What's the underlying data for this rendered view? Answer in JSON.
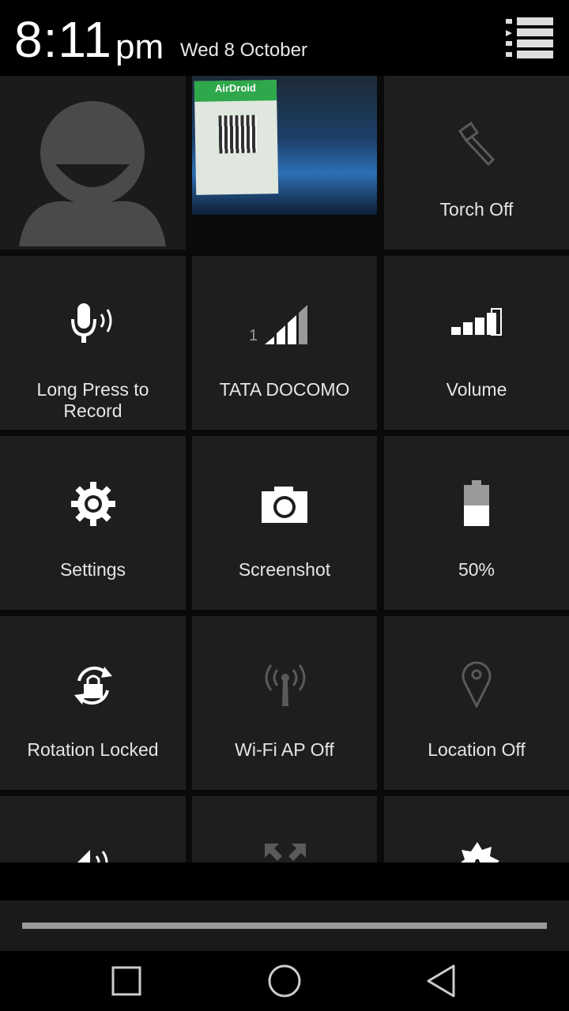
{
  "status": {
    "time": "8:11",
    "ampm": "pm",
    "date": "Wed 8 October"
  },
  "photo": {
    "card_title": "AirDroid"
  },
  "tiles": {
    "torch": "Torch Off",
    "voice": "Long Press to Record",
    "signal": "TATA DOCOMO",
    "signal_sim": "1",
    "volume": "Volume",
    "settings": "Settings",
    "screenshot": "Screenshot",
    "battery": "50%",
    "rotation": "Rotation Locked",
    "wifi_ap": "Wi-Fi AP Off",
    "location": "Location Off"
  },
  "battery_level": 0.5,
  "icons": {
    "settings_list": "settings-list-icon",
    "avatar": "user-avatar-icon",
    "torch": "flashlight-icon",
    "mic": "microphone-icon",
    "signal": "signal-icon",
    "volume": "volume-bars-icon",
    "gear": "gear-icon",
    "camera": "camera-icon",
    "battery": "battery-icon",
    "rotation": "rotation-lock-icon",
    "hotspot": "wifi-hotspot-icon",
    "location": "location-pin-icon",
    "sound": "sound-icon",
    "expand": "expand-icon",
    "brightness": "brightness-icon",
    "nav_recent": "recent-apps-icon",
    "nav_home": "home-icon",
    "nav_back": "back-icon"
  },
  "colors": {
    "tile_bg": "#1e1e1e",
    "icon_active": "#ffffff",
    "icon_inactive": "#5a5a5a",
    "handle": "#9a9a9a"
  }
}
